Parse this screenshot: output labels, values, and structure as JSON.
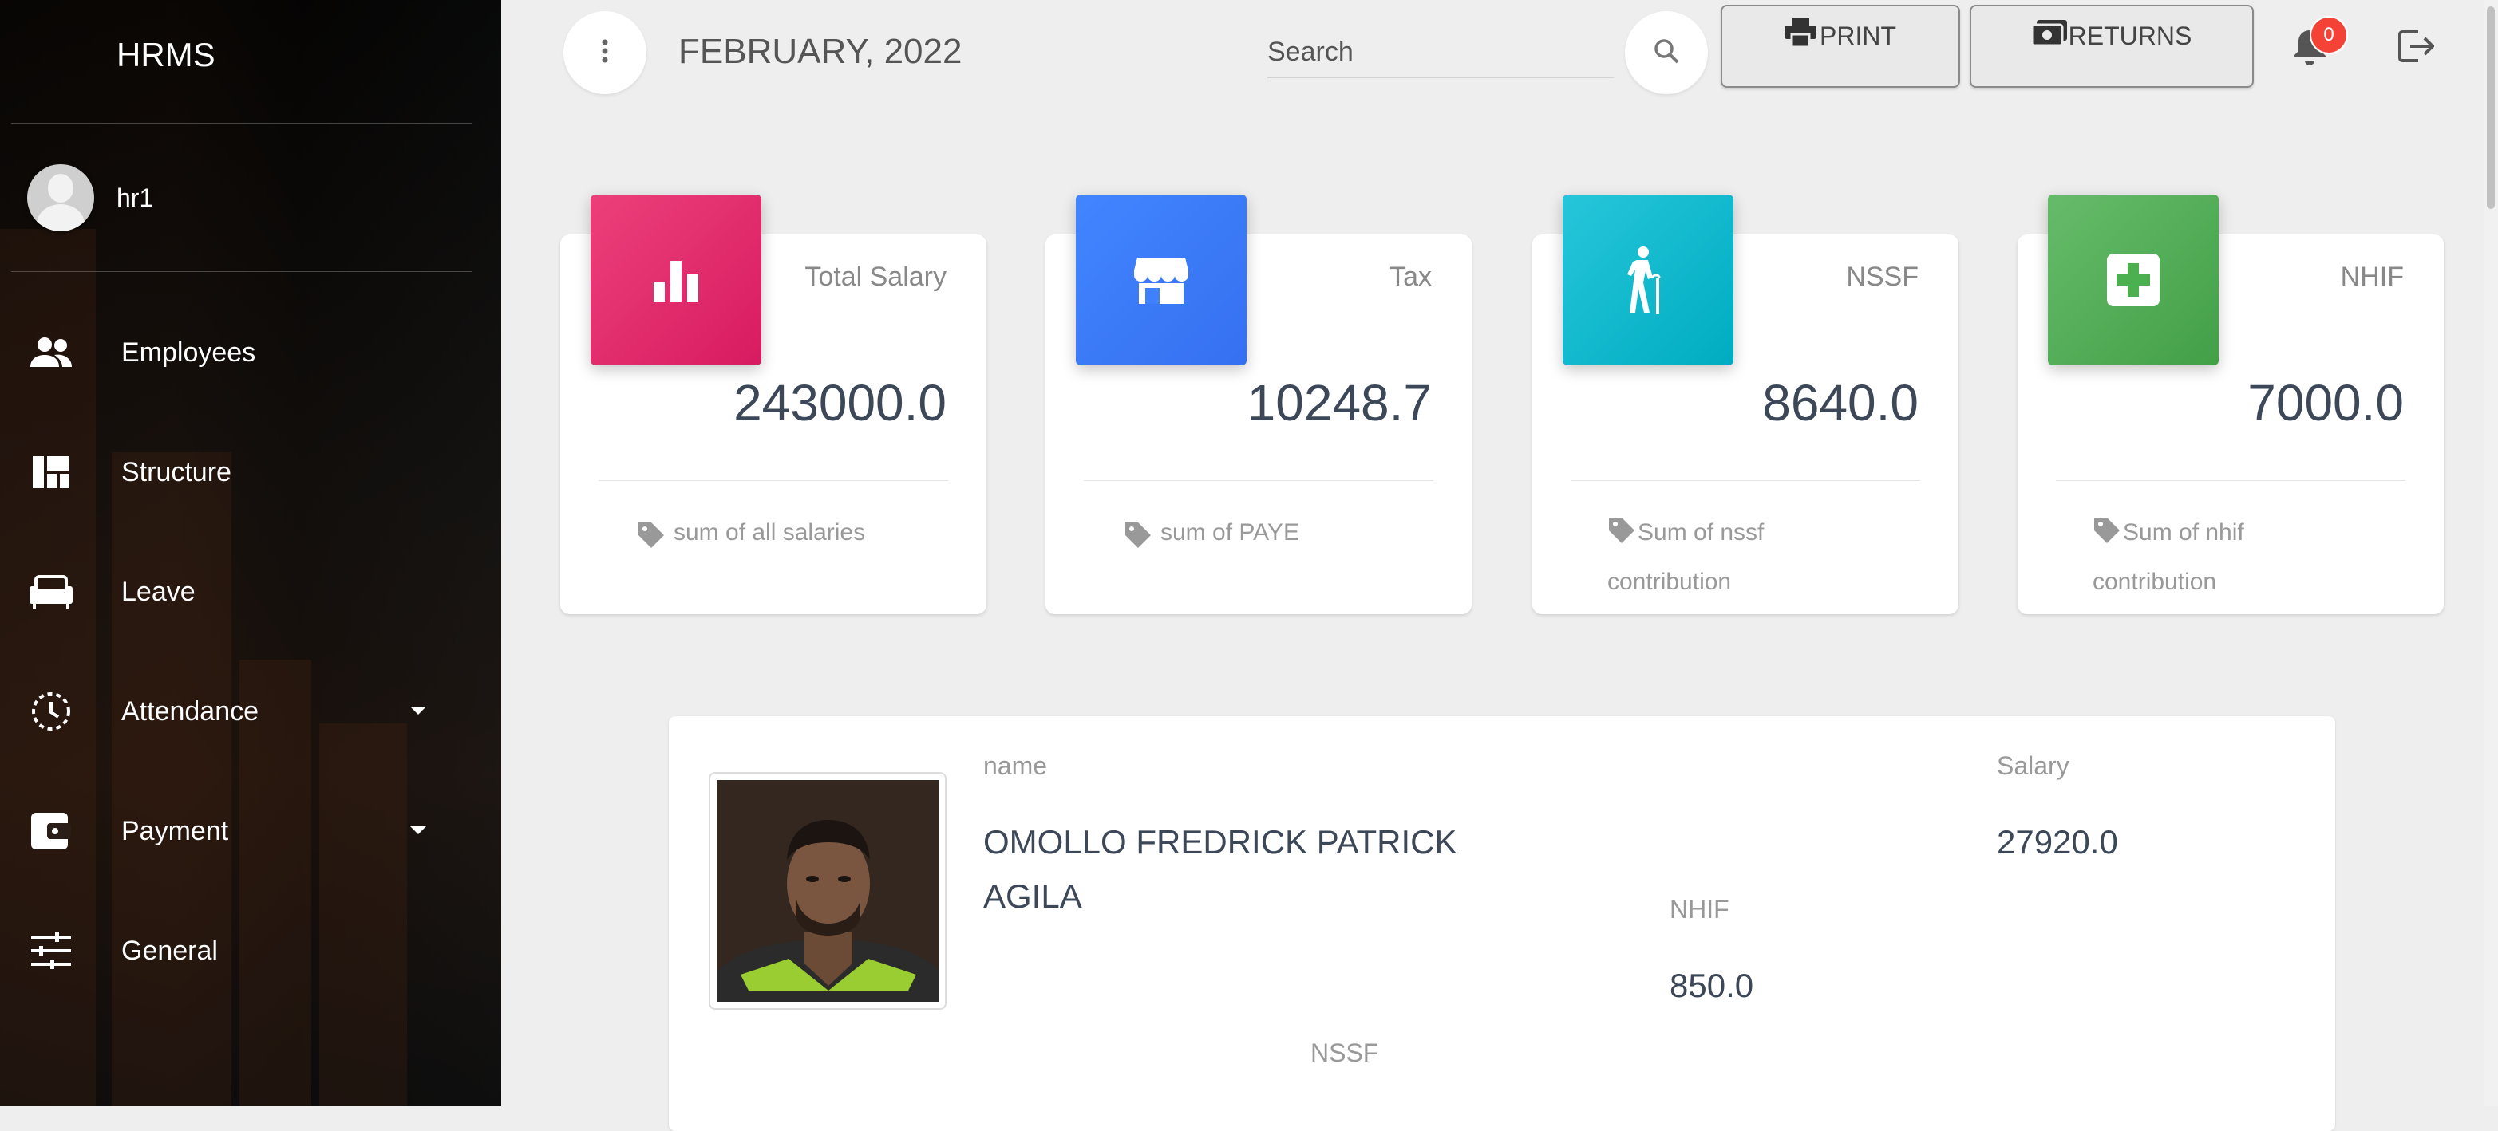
{
  "sidebar": {
    "brand": "HRMS",
    "user": {
      "name": "hr1"
    },
    "items": [
      {
        "label": "Employees",
        "icon": "people-icon"
      },
      {
        "label": "Structure",
        "icon": "dashboard-grid-icon"
      },
      {
        "label": "Leave",
        "icon": "sofa-icon"
      },
      {
        "label": "Attendance",
        "icon": "clock-dashed-icon",
        "has_dropdown": true
      },
      {
        "label": "Payment",
        "icon": "wallet-icon",
        "has_dropdown": true
      },
      {
        "label": "General",
        "icon": "sliders-icon"
      }
    ]
  },
  "header": {
    "title": "FEBRUARY, 2022",
    "search_placeholder": "Search",
    "print_label": "PRINT",
    "returns_label": "RETURNS",
    "notifications_count": "0"
  },
  "stats": [
    {
      "label": "Total Salary",
      "value": "243000.0",
      "footer": "sum of all salaries",
      "icon": "bar-chart-icon",
      "color": "#e91e63"
    },
    {
      "label": "Tax",
      "value": "10248.7",
      "footer": "sum of PAYE",
      "icon": "store-icon",
      "color": "#3f80ff"
    },
    {
      "label": "NSSF",
      "value": "8640.0",
      "footer": "Sum of nssf contribution",
      "icon": "elderly-walking-icon",
      "color": "#00bcd4"
    },
    {
      "label": "NHIF",
      "value": "7000.0",
      "footer": "Sum of nhif contribution",
      "icon": "medical-cross-icon",
      "color": "#4caf50"
    }
  ],
  "employee": {
    "name_label": "name",
    "name": "OMOLLO FREDRICK PATRICK AGILA",
    "salary_label": "Salary",
    "salary": "27920.0",
    "nhif_label": "NHIF",
    "nhif": "850.0",
    "nssf_label": "NSSF"
  }
}
